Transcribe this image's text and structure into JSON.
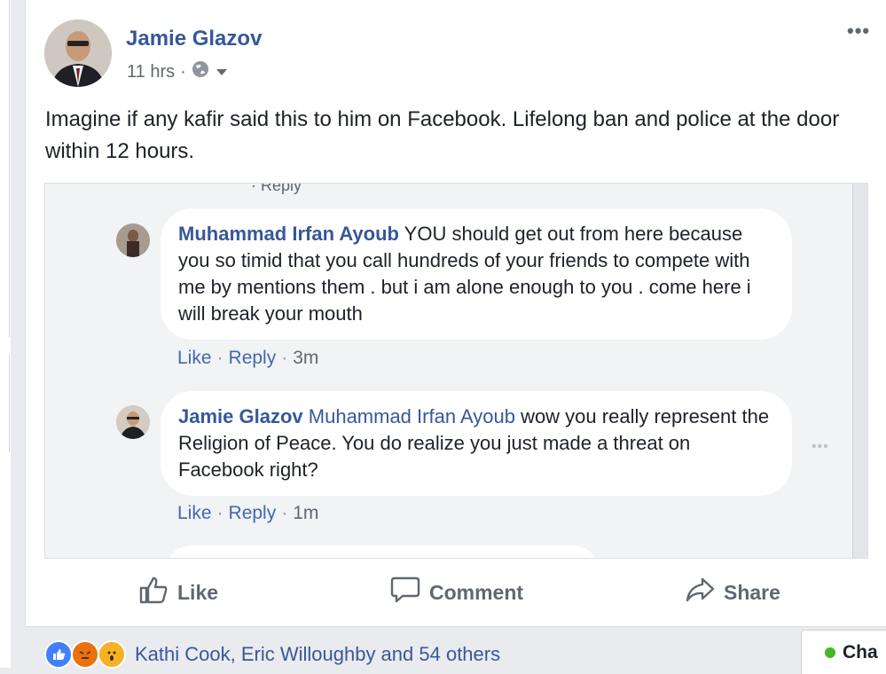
{
  "post": {
    "author": "Jamie Glazov",
    "time": "11 hrs",
    "dot": "·",
    "privacy_icon": "globe-icon",
    "text": "Imagine if any kafir said this to him on Facebook. Lifelong ban and police at the door within 12 hours.",
    "more_label": "•••"
  },
  "embed": {
    "comments": [
      {
        "author": "Muhammad Irfan Ayoub",
        "tag": "",
        "text": "YOU should get out from here because you so timid that you call hundreds of your friends to compete with me by mentions them . but i am alone enough to you . come here i will break your mouth",
        "like": "Like",
        "reply": "Reply",
        "time": "3m"
      },
      {
        "author": "Jamie Glazov",
        "tag": "Muhammad Irfan Ayoub",
        "text": "wow you really represent the Religion of Peace. You do realize you just made a threat on Facebook right?",
        "like": "Like",
        "reply": "Reply",
        "time": "1m",
        "more_label": "•••"
      }
    ]
  },
  "actions": {
    "like": "Like",
    "comment": "Comment",
    "share": "Share"
  },
  "reactions": {
    "icons": [
      "like-icon",
      "angry-icon",
      "wow-icon"
    ],
    "text": "Kathi Cook, Eric Willoughby and 54 others"
  },
  "chat": {
    "label": "Cha",
    "status_color": "#42b72a"
  },
  "colors": {
    "link": "#365899",
    "action_link": "#4267b2",
    "page_bg": "#e9ebee"
  }
}
